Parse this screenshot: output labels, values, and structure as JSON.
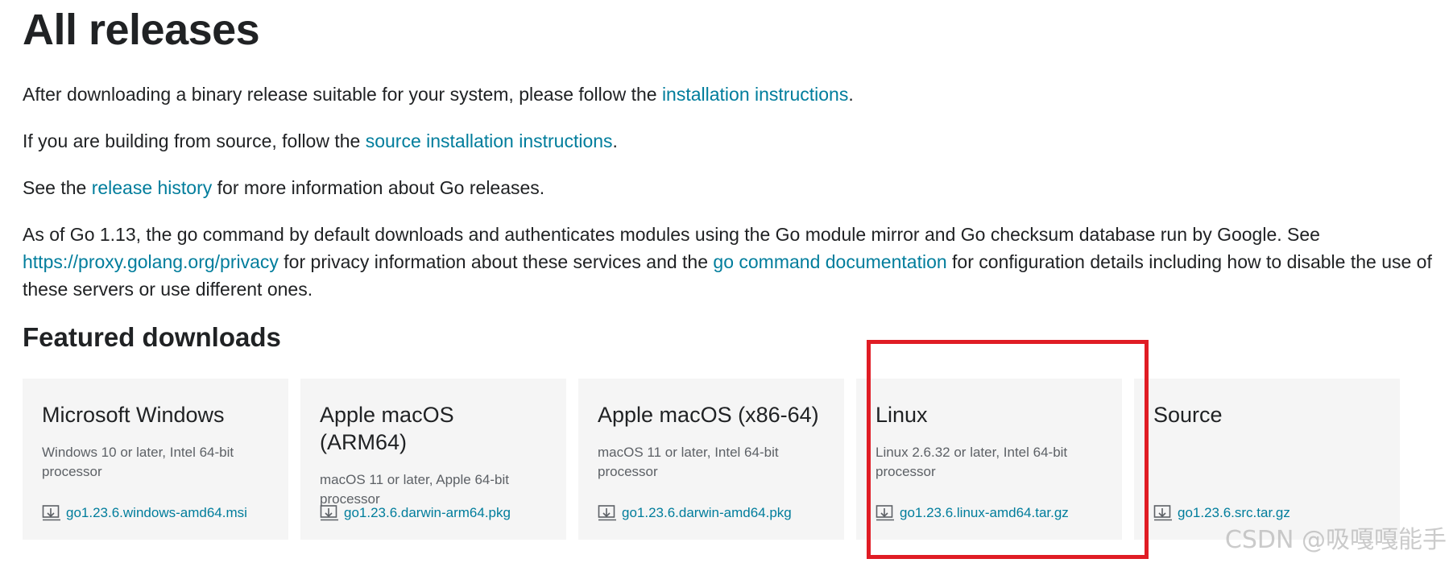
{
  "page": {
    "title": "All releases",
    "intro": {
      "p1_before": "After downloading a binary release suitable for your system, please follow the ",
      "p1_link": "installation instructions",
      "p1_after": ".",
      "p2_before": "If you are building from source, follow the ",
      "p2_link": "source installation instructions",
      "p2_after": ".",
      "p3_before": "See the ",
      "p3_link": "release history",
      "p3_after": " for more information about Go releases.",
      "p4_before": "As of Go 1.13, the go command by default downloads and authenticates modules using the Go module mirror and Go checksum database run by Google. See ",
      "p4_link1": "https://proxy.golang.org/privacy",
      "p4_mid": " for privacy information about these services and the ",
      "p4_link2": "go command documentation",
      "p4_after": " for configuration details including how to disable the use of these servers or use different ones."
    },
    "featured_heading": "Featured downloads",
    "downloads": [
      {
        "title": "Microsoft Windows",
        "desc": "Windows 10 or later, Intel 64-bit processor",
        "file": "go1.23.6.windows-amd64.msi"
      },
      {
        "title": "Apple macOS (ARM64)",
        "desc": "macOS 11 or later, Apple 64-bit processor",
        "file": "go1.23.6.darwin-arm64.pkg"
      },
      {
        "title": "Apple macOS (x86-64)",
        "desc": "macOS 11 or later, Intel 64-bit processor",
        "file": "go1.23.6.darwin-amd64.pkg"
      },
      {
        "title": "Linux",
        "desc": "Linux 2.6.32 or later, Intel 64-bit processor",
        "file": "go1.23.6.linux-amd64.tar.gz"
      },
      {
        "title": "Source",
        "desc": "",
        "file": "go1.23.6.src.tar.gz"
      }
    ],
    "watermark": "CSDN @吸嘎嘎能手",
    "colors": {
      "link": "#007d9c",
      "highlight": "#e01c24",
      "card_bg": "#f5f5f5"
    }
  }
}
